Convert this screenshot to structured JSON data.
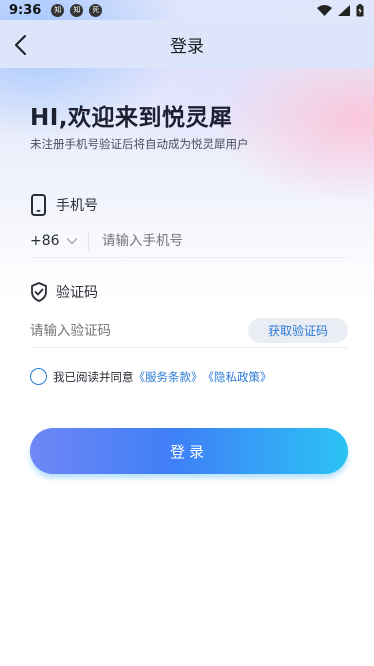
{
  "status_bar": {
    "time": "9:36",
    "app_icons": [
      "知",
      "知",
      "死"
    ]
  },
  "header": {
    "title": "登录"
  },
  "welcome": {
    "title": "HI,欢迎来到悦灵犀",
    "subtitle": "未注册手机号验证后将自动成为悦灵犀用户"
  },
  "phone": {
    "label": "手机号",
    "country_code": "+86",
    "placeholder": "请输入手机号"
  },
  "code": {
    "label": "验证码",
    "placeholder": "请输入验证码",
    "get_code_label": "获取验证码"
  },
  "agreement": {
    "prefix": "我已阅读并同意",
    "terms_link": "《服务条款》",
    "privacy_link": "《隐私政策》"
  },
  "login_button": {
    "label": "登录"
  },
  "colors": {
    "accent": "#2a7ad8",
    "button_gradient_start": "#6f86f6",
    "button_gradient_end": "#2bc3f4"
  }
}
